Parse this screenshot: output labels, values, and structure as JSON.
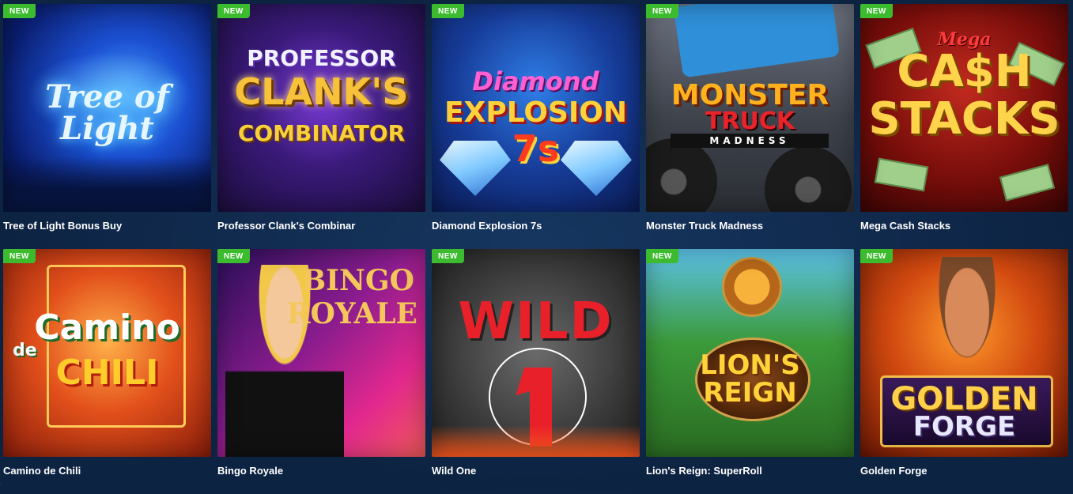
{
  "badge_label": "NEW",
  "games": [
    {
      "title": "Tree of Light Bonus Buy",
      "logo": [
        "Tree of Light"
      ]
    },
    {
      "title": "Professor Clank's Combinar",
      "logo": [
        "PROFESSOR",
        "CLANK'S",
        "COMBINATOR"
      ]
    },
    {
      "title": "Diamond Explosion 7s",
      "logo": [
        "Diamond",
        "EXPLOSION",
        "7s"
      ]
    },
    {
      "title": "Monster Truck Madness",
      "logo": [
        "MONSTER",
        "TRUCK",
        "MADNESS"
      ]
    },
    {
      "title": "Mega Cash Stacks",
      "logo": [
        "Mega",
        "CA$H",
        "STACKS"
      ]
    },
    {
      "title": "Camino de Chili",
      "logo": [
        "Camino",
        "de",
        "CHILI"
      ]
    },
    {
      "title": "Bingo Royale",
      "logo": [
        "BINGO",
        "ROYALE"
      ]
    },
    {
      "title": "Wild One",
      "logo": [
        "WILD"
      ]
    },
    {
      "title": "Lion's Reign: SuperRoll",
      "logo": [
        "LION'S",
        "REIGN"
      ]
    },
    {
      "title": "Golden Forge",
      "logo": [
        "GOLDEN",
        "FORGE"
      ]
    }
  ],
  "colors": {
    "background": "#0f2747",
    "badge": "#3dbb2f",
    "caption": "#ffffff"
  }
}
